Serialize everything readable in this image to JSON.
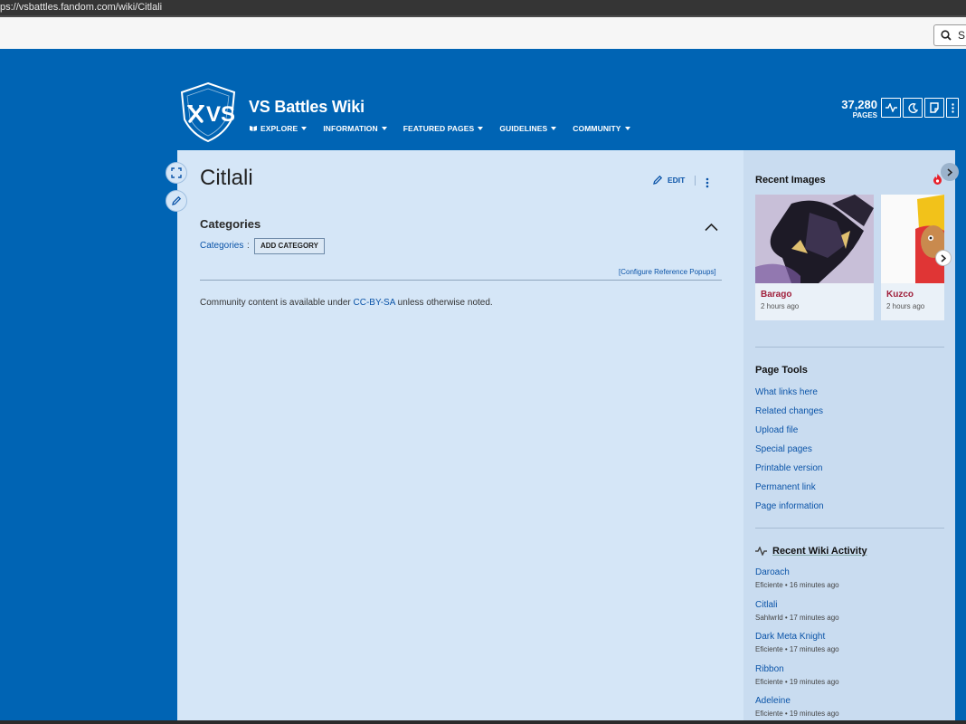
{
  "browser": {
    "url": "ps://vsbattles.fandom.com/wiki/Citlali",
    "search_hint": "S"
  },
  "header": {
    "wiki_name": "VS Battles Wiki",
    "logo_text": "VS",
    "nav": [
      {
        "label": "EXPLORE"
      },
      {
        "label": "INFORMATION"
      },
      {
        "label": "FEATURED PAGES"
      },
      {
        "label": "GUIDELINES"
      },
      {
        "label": "COMMUNITY"
      }
    ],
    "page_count": "37,280",
    "page_count_label": "PAGES"
  },
  "article": {
    "title": "Citlali",
    "edit_label": "EDIT",
    "categories_heading": "Categories",
    "categories_link": "Categories",
    "categories_colon": ":",
    "add_category_label": "ADD CATEGORY",
    "config_ref_popups": "[Configure Reference Popups]",
    "license_prefix": "Community content is available under ",
    "license_link": "CC-BY-SA",
    "license_suffix": " unless otherwise noted."
  },
  "rail": {
    "recent_images_heading": "Recent Images",
    "recent_images": [
      {
        "name": "Barago",
        "time": "2 hours ago"
      },
      {
        "name": "Kuzco",
        "time": "2 hours ago"
      }
    ],
    "page_tools_heading": "Page Tools",
    "page_tools": [
      "What links here",
      "Related changes",
      "Upload file",
      "Special pages",
      "Printable version",
      "Permanent link",
      "Page information"
    ],
    "activity_heading": "Recent Wiki Activity",
    "activity": [
      {
        "title": "Daroach",
        "meta": "Eficiente • 16 minutes ago"
      },
      {
        "title": "Citlali",
        "meta": "Sahlwrld • 17 minutes ago"
      },
      {
        "title": "Dark Meta Knight",
        "meta": "Eficiente • 17 minutes ago"
      },
      {
        "title": "Ribbon",
        "meta": "Eficiente • 19 minutes ago"
      },
      {
        "title": "Adeleine",
        "meta": "Eficiente • 19 minutes ago"
      }
    ]
  },
  "colors": {
    "community_bg": "#0064b4",
    "page_bg": "#d5e6f7",
    "rail_bg": "#c9dcf0",
    "link": "#0b54a8",
    "image_title": "#a0203c"
  }
}
